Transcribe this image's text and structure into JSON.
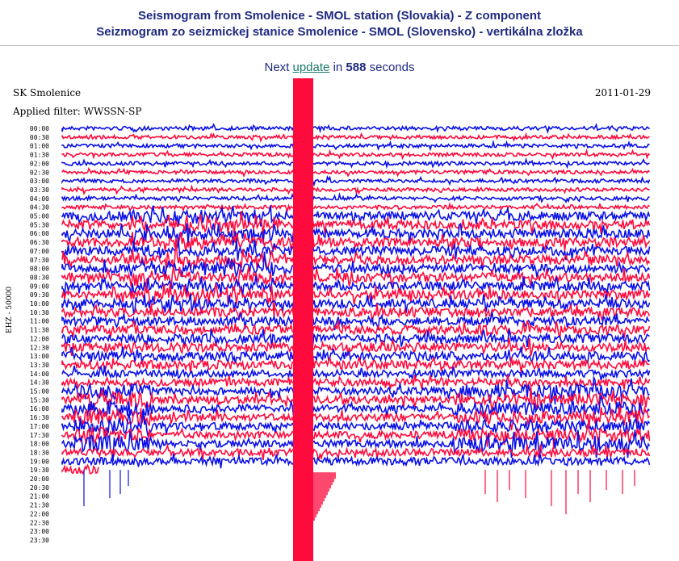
{
  "header": {
    "title_en": "Seismogram from Smolenice - SMOL station (Slovakia) - Z component",
    "title_sk": "Seizmogram zo seizmickej stanice Smolenice - SMOL (Slovensko) - vertikálna zložka"
  },
  "update": {
    "prefix": "Next",
    "link_label": "update",
    "middle": "in",
    "seconds": "588",
    "suffix": "seconds"
  },
  "plot": {
    "station": "SK Smolenice",
    "date": "2011-01-29",
    "filter": "Applied filter: WWSSN-SP",
    "channel_label": "EHZ - 50000",
    "colors": {
      "blue": "#0a10e6",
      "red": "#ff0a3c"
    },
    "time_labels": [
      "00:00",
      "00:30",
      "01:00",
      "01:30",
      "02:00",
      "02:30",
      "03:00",
      "03:30",
      "04:00",
      "04:30",
      "05:00",
      "05:30",
      "06:00",
      "06:30",
      "07:00",
      "07:30",
      "08:00",
      "08:30",
      "09:00",
      "09:30",
      "10:00",
      "10:30",
      "11:00",
      "11:30",
      "12:00",
      "12:30",
      "13:00",
      "13:30",
      "14:00",
      "14:30",
      "15:00",
      "15:30",
      "16:00",
      "16:30",
      "17:00",
      "17:30",
      "18:00",
      "18:30",
      "19:00",
      "19:30",
      "20:00",
      "20:30",
      "21:00",
      "21:30",
      "22:00",
      "22:30",
      "23:00",
      "23:30"
    ]
  }
}
